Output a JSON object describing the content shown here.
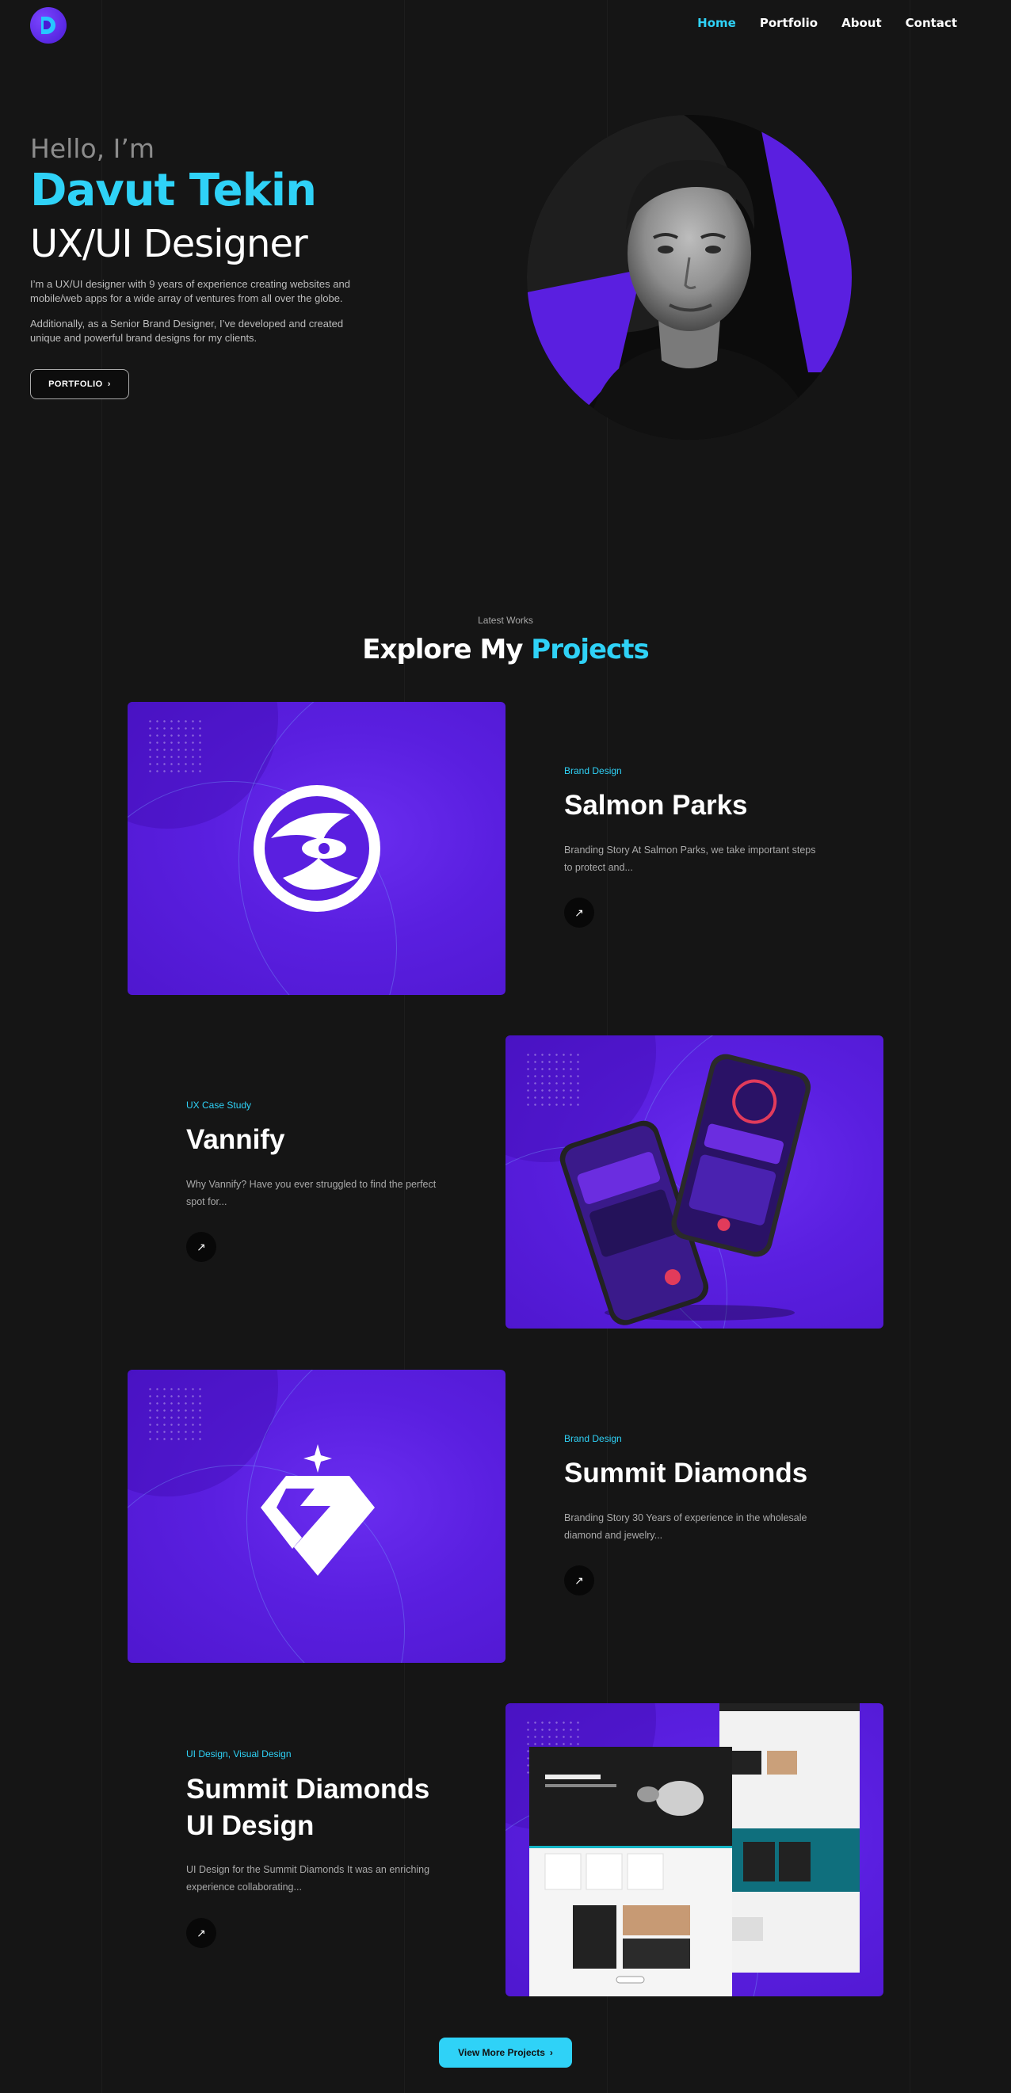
{
  "nav": {
    "items": [
      {
        "label": "Home",
        "active": true
      },
      {
        "label": "Portfolio",
        "active": false
      },
      {
        "label": "About",
        "active": false
      },
      {
        "label": "Contact",
        "active": false
      }
    ]
  },
  "hero": {
    "greeting": "Hello, I’m",
    "name": "Davut Tekin",
    "role": "UX/UI Designer",
    "intro_1": "I’m a UX/UI designer with 9 years of experience creating websites and mobile/web apps for a wide array of ventures from all over the globe.",
    "intro_2": "Additionally, as a Senior Brand Designer, I’ve developed and created unique and powerful brand designs for my clients.",
    "portfolio_button": "PORTFOLIO",
    "chevron_icon": "chevron-right-icon"
  },
  "works": {
    "eyebrow": "Latest Works",
    "title_plain": "Explore My",
    "title_accent": "Projects"
  },
  "projects": [
    {
      "tag": "Brand Design",
      "title": "Salmon Parks",
      "description": "Branding Story At Salmon Parks, we take important steps to protect and...",
      "icon": "arrow-up-right-icon"
    },
    {
      "tag": "UX Case Study",
      "title": "Vannify",
      "description": "Why Vannify? Have you ever struggled to find the perfect spot for...",
      "icon": "arrow-up-right-icon"
    },
    {
      "tag": "Brand Design",
      "title": "Summit Diamonds",
      "description": "Branding Story 30 Years of experience in the wholesale diamond and jewelry...",
      "icon": "arrow-up-right-icon"
    },
    {
      "tag": "UI Design, Visual Design",
      "title_line1": "Summit Diamonds",
      "title_line2": "UI Design",
      "description": "UI Design for the Summit Diamonds It was an enriching experience collaborating...",
      "icon": "arrow-up-right-icon"
    }
  ],
  "more_button": "View More Projects",
  "colors": {
    "background": "#151515",
    "accent_cyan": "#2fd2f7",
    "brand_purple": "#5a1fe0"
  }
}
